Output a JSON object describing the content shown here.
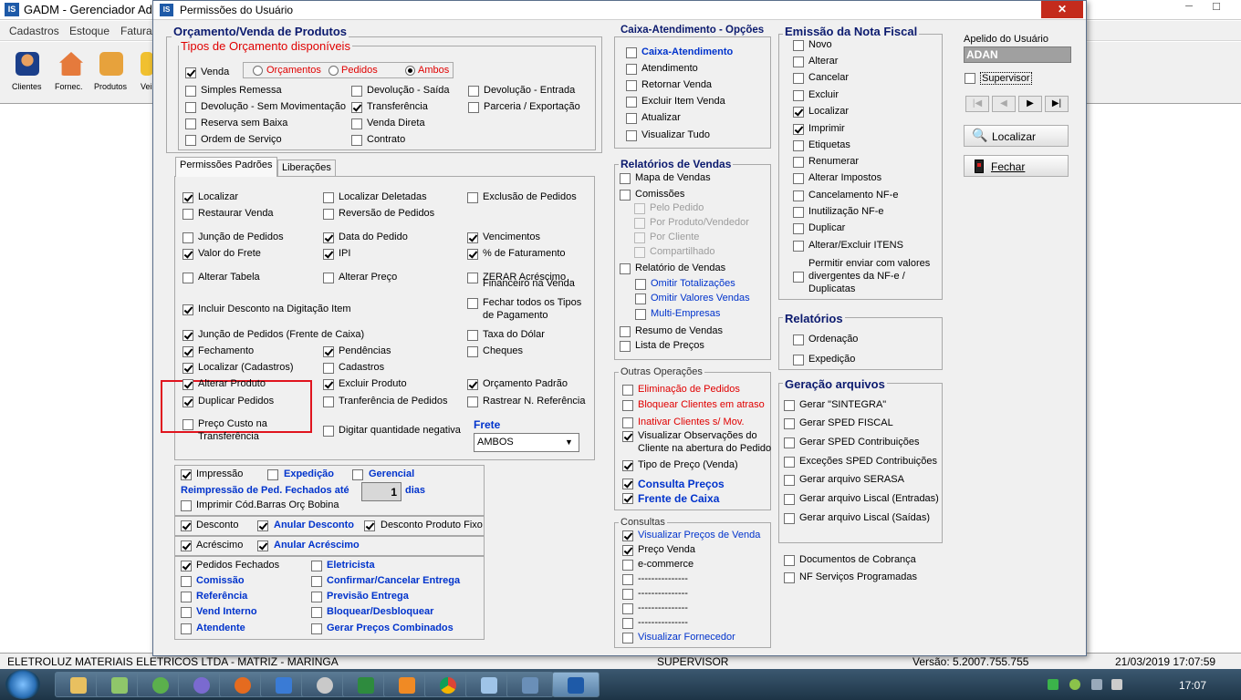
{
  "bg": {
    "title": "GADM - Gerenciador Admi",
    "menu": [
      "Cadastros",
      "Estoque",
      "Faturar"
    ],
    "toolbar": [
      "Clientes",
      "Fornec.",
      "Produtos",
      "Vei"
    ],
    "status": {
      "company": "ELETROLUZ MATERIAIS ELETRICOS LTDA - MATRIZ - MARINGA",
      "user": "SUPERVISOR",
      "version": "Versão: 5.2007.755.755",
      "datetime": "21/03/2019 17:07:59"
    }
  },
  "taskbar": {
    "clock": "17:07"
  },
  "dialog": {
    "title": "Permissões do Usuário",
    "orc": {
      "title": "Orçamento/Venda de Produtos",
      "tipos": "Tipos de Orçamento disponíveis",
      "venda": "Venda",
      "radios": [
        "Orçamentos",
        "Pedidos",
        "Ambos"
      ],
      "items": [
        "Simples Remessa",
        "Devolução - Saída",
        "Devolução - Entrada",
        "Devolução - Sem Movimentação",
        "Transferência",
        "Parceria / Exportação",
        "Reserva sem Baixa",
        "Venda Direta",
        "Ordem de Serviço",
        "Contrato"
      ]
    },
    "tabs": [
      "Permissões Padrões",
      "Liberações"
    ],
    "perm": [
      "Localizar",
      "Localizar Deletadas",
      "Exclusão de Pedidos",
      "Restaurar Venda",
      "Reversão de Pedidos",
      "Junção de Pedidos",
      "Data do Pedido",
      "Vencimentos",
      "Valor do Frete",
      "IPI",
      "% de Faturamento",
      "Alterar Tabela",
      "Alterar Preço",
      "ZERAR Acréscimo",
      "Financeiro na Venda",
      "Incluir Desconto na Digitação Item",
      "Fechar todos os Tipos",
      "de Pagamento",
      "Junção de Pedidos (Frente de Caixa)",
      "Taxa do Dólar",
      "Fechamento",
      "Pendências",
      "Cheques",
      "Localizar (Cadastros)",
      "Cadastros",
      "Alterar Produto",
      "Excluir Produto",
      "Orçamento Padrão",
      "Duplicar Pedidos",
      "Tranferência de Pedidos",
      "Rastrear N. Referência",
      "Preço Custo na",
      "Transferência",
      "Digitar quantidade negativa"
    ],
    "frete": {
      "label": "Frete",
      "value": "AMBOS"
    },
    "imp": {
      "impressao": "Impressão",
      "expedicao": "Expedição",
      "gerencial": "Gerencial",
      "reimp": "Reimpressão de Ped. Fechados até",
      "reimp_val": "1",
      "dias": "dias",
      "bobina": "Imprimir Cód.Barras Orç Bobina"
    },
    "desc": {
      "desconto": "Desconto",
      "anular": "Anular Desconto",
      "fixo": "Desconto Produto Fixo",
      "acr": "Acréscimo",
      "anular_acr": "Anular Acréscimo"
    },
    "ped": [
      "Pedidos Fechados",
      "Eletricista",
      "Comissão",
      "Confirmar/Cancelar Entrega",
      "Referência",
      "Previsão Entrega",
      "Vend Interno",
      "Bloquear/Desbloquear",
      "Atendente",
      "Gerar Preços Combinados"
    ],
    "caixa": {
      "title": "Caixa-Atendimento - Opções",
      "items": [
        "Caixa-Atendimento",
        "Atendimento",
        "Retornar Venda",
        "Excluir Item Venda",
        "Atualizar",
        "Visualizar Tudo"
      ]
    },
    "relv": {
      "title": "Relatórios de Vendas",
      "items": [
        "Mapa de Vendas",
        "Comissões",
        "Pelo Pedido",
        "Por Produto/Vendedor",
        "Por Cliente",
        "Compartilhado",
        "Relatório de Vendas",
        "Omitir Totalizações",
        "Omitir Valores Vendas",
        "Multi-Empresas",
        "Resumo de Vendas",
        "Lista de Preços"
      ]
    },
    "outras": {
      "title": "Outras Operações",
      "items": [
        "Eliminação de Pedidos",
        "Bloquear Clientes em atraso",
        "Inativar Clientes s/ Mov.",
        "Visualizar Observações do",
        "Cliente na abertura do Pedido",
        "Tipo de Preço (Venda)",
        "Consulta Preços",
        "Frente de Caixa"
      ]
    },
    "consultas": {
      "title": "Consultas",
      "items": [
        "Visualizar Preços de Venda",
        "Preço Venda",
        "e-commerce",
        "---------------",
        "---------------",
        "---------------",
        "---------------",
        "Visualizar Fornecedor"
      ]
    },
    "nf": {
      "title": "Emissão da Nota Fiscal",
      "items": [
        "Novo",
        "Alterar",
        "Cancelar",
        "Excluir",
        "Localizar",
        "Imprimir",
        "Etiquetas",
        "Renumerar",
        "Alterar Impostos",
        "Cancelamento NF-e",
        "Inutilização NF-e",
        "Duplicar",
        "Alterar/Excluir ITENS",
        "Permitir enviar com valores",
        "divergentes da NF-e /",
        "Duplicatas"
      ]
    },
    "rel": {
      "title": "Relatórios",
      "items": [
        "Ordenação",
        "Expedição"
      ]
    },
    "ger": {
      "title": "Geração arquivos",
      "items": [
        "Gerar \"SINTEGRA\"",
        "Gerar SPED FISCAL",
        "Gerar SPED Contribuições",
        "Exceções SPED Contribuições",
        "Gerar arquivo SERASA",
        "Gerar arquivo Liscal (Entradas)",
        "Gerar arquivo Liscal (Saídas)"
      ]
    },
    "extra": [
      "Documentos de Cobrança",
      "NF Serviços Programadas"
    ],
    "side": {
      "apelido_label": "Apelido do Usuário",
      "apelido": "ADAN",
      "supervisor": "Supervisor",
      "localizar": "Localizar",
      "fechar": "Fechar"
    }
  }
}
